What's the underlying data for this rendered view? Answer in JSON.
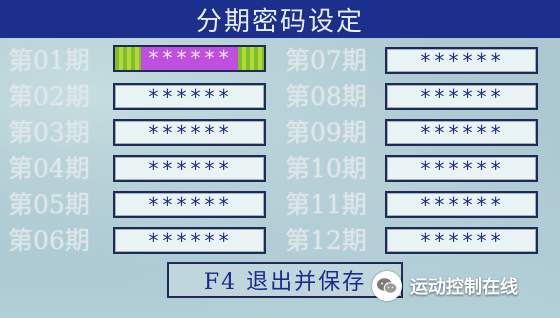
{
  "title": "分期密码设定",
  "left_column": [
    {
      "label": "第01期",
      "value": "******",
      "active": true
    },
    {
      "label": "第02期",
      "value": "******"
    },
    {
      "label": "第03期",
      "value": "******"
    },
    {
      "label": "第04期",
      "value": "******"
    },
    {
      "label": "第05期",
      "value": "******"
    },
    {
      "label": "第06期",
      "value": "******"
    }
  ],
  "right_column": [
    {
      "label": "第07期",
      "value": "******"
    },
    {
      "label": "第08期",
      "value": "******"
    },
    {
      "label": "第09期",
      "value": "******"
    },
    {
      "label": "第10期",
      "value": "******"
    },
    {
      "label": "第11期",
      "value": "******"
    },
    {
      "label": "第12期",
      "value": "******"
    }
  ],
  "exit_button": {
    "label": "F4 退出并保存"
  },
  "watermark": {
    "text": "运动控制在线",
    "icon": "wechat-icon"
  },
  "colors": {
    "title_bar": "#1d2f8c",
    "active_field": "#c04fe0",
    "active_field_edge": "#7fbf2a",
    "field_text": "#1e2f86"
  }
}
